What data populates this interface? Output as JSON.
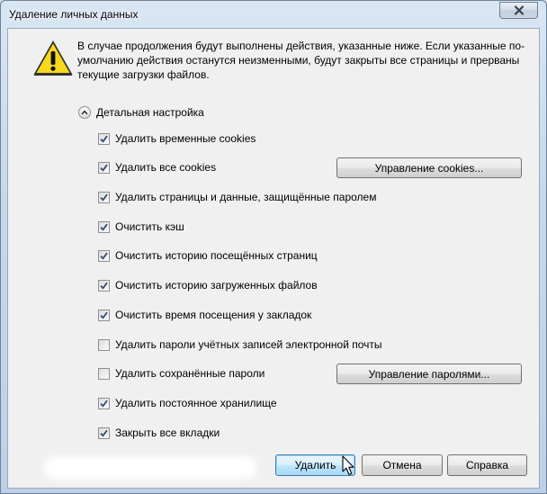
{
  "window": {
    "title": "Удаление личных данных"
  },
  "message": {
    "lines": [
      "В случае продолжения будут выполнены действия, указанные ниже. Если указанные по-",
      "умолчанию действия останутся неизменными, будут закрыты все страницы и прерваны",
      "текущие загрузки файлов."
    ]
  },
  "details": {
    "label": "Детальная настройка",
    "expanded": true
  },
  "options": [
    {
      "label": "Удалить временные cookies",
      "checked": true
    },
    {
      "label": "Удалить все cookies",
      "checked": true
    },
    {
      "label": "Удалить страницы и данные, защищённые паролем",
      "checked": true
    },
    {
      "label": "Очистить кэш",
      "checked": true
    },
    {
      "label": "Очистить историю посещённых страниц",
      "checked": true
    },
    {
      "label": "Очистить историю загруженных файлов",
      "checked": true
    },
    {
      "label": "Очистить время посещения у закладок",
      "checked": true
    },
    {
      "label": "Удалить пароли учётных записей электронной почты",
      "checked": false
    },
    {
      "label": "Удалить сохранённые пароли",
      "checked": false
    },
    {
      "label": "Удалить постоянное хранилище",
      "checked": true
    },
    {
      "label": "Закрыть все вкладки",
      "checked": true
    }
  ],
  "manage_buttons": {
    "cookies": "Управление cookies...",
    "passwords": "Управление паролями..."
  },
  "footer": {
    "delete": "Удалить",
    "cancel": "Отмена",
    "help": "Справка"
  },
  "icons": {
    "warning": "warning-icon",
    "close": "close-icon",
    "collapse": "chevron-up-icon",
    "check": "checkmark-icon",
    "cursor": "mouse-pointer-icon"
  },
  "colors": {
    "warning_fill": "#f7d81c",
    "checkmark": "#3a4a73",
    "default_button_border": "#3c7fb1"
  }
}
